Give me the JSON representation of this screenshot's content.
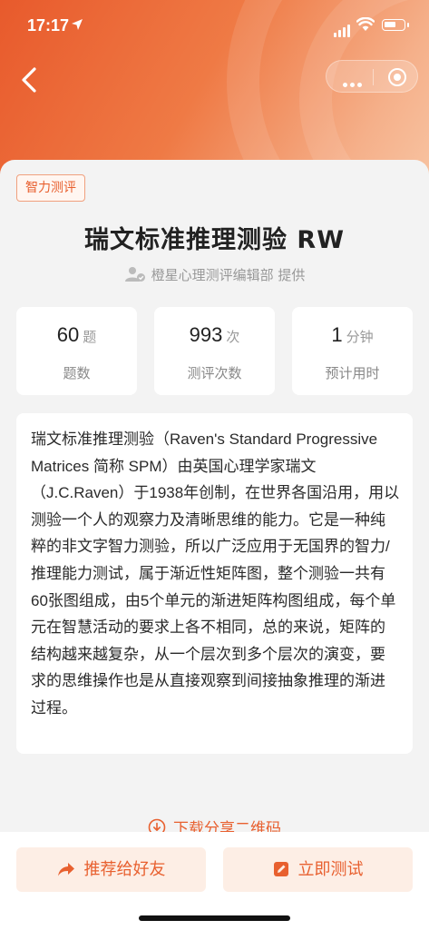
{
  "status_bar": {
    "time": "17:17"
  },
  "nav": {
    "back_icon": "chevron-left-icon",
    "more_icon": "more-dots-icon",
    "close_icon": "target-circle-icon"
  },
  "tag": "智力测评",
  "title": "瑞文标准推理测验 RW",
  "provider": "橙星心理测评编辑部 提供",
  "stats": [
    {
      "value": "60",
      "unit": "题",
      "label": "题数"
    },
    {
      "value": "993",
      "unit": "次",
      "label": "测评次数"
    },
    {
      "value": "1",
      "unit": "分钟",
      "label": "预计用时"
    }
  ],
  "description": "瑞文标准推理测验（Raven's Standard Progressive Matrices 简称 SPM）由英国心理学家瑞文（J.C.Raven）于1938年创制，在世界各国沿用，用以测验一个人的观察力及清晰思维的能力。它是一种纯粹的非文字智力测验，所以广泛应用于无国界的智力/推理能力测试，属于渐近性矩阵图，整个测验一共有60张图组成，由5个单元的渐进矩阵构图组成，每个单元在智慧活动的要求上各不相同，总的来说，矩阵的结构越来越复杂，从一个层次到多个层次的演变，要求的思维操作也是从直接观察到间接抽象推理的渐进过程。",
  "download_label": "下载分享二维码",
  "buttons": {
    "share": "推荐给好友",
    "start": "立即测试"
  },
  "colors": {
    "accent": "#e8602f",
    "button_bg": "#fdeee5",
    "page_bg": "#f3f3f3"
  }
}
